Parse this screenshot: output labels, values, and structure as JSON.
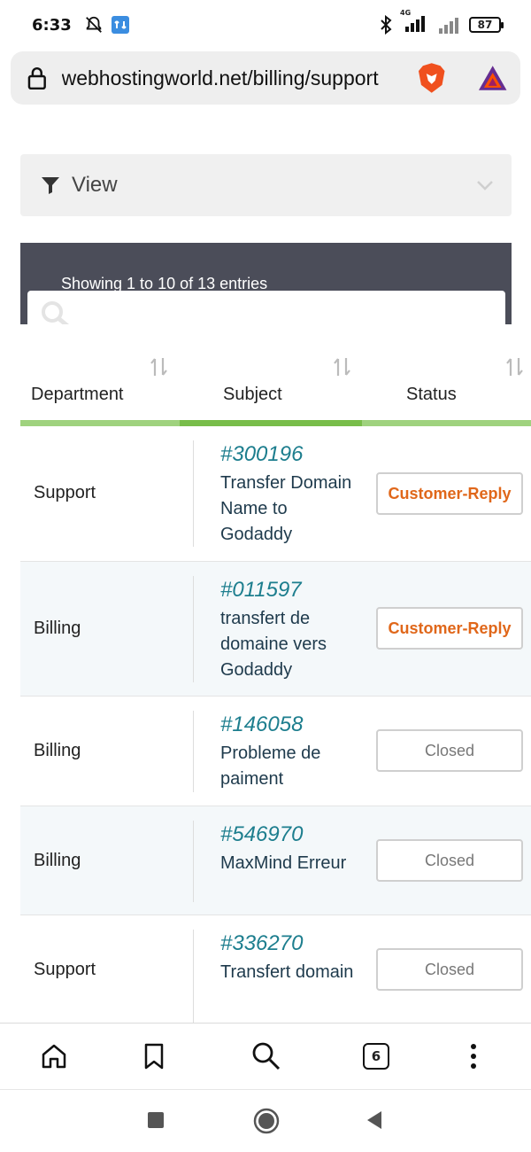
{
  "status_bar": {
    "time": "6:33",
    "network": "4G",
    "battery": "87"
  },
  "browser": {
    "url": "webhostingworld.net/billing/support",
    "tab_count": "6"
  },
  "filter": {
    "label": "View"
  },
  "table": {
    "info": "Showing 1 to 10 of 13 entries",
    "columns": [
      "Department",
      "Subject",
      "Status"
    ],
    "rows": [
      {
        "department": "Support",
        "ticket": "#300196",
        "subject": "Transfer Domain Name to Godaddy",
        "status": "Customer-Reply"
      },
      {
        "department": "Billing",
        "ticket": "#011597",
        "subject": "transfert de domaine vers Godaddy",
        "status": "Customer-Reply"
      },
      {
        "department": "Billing",
        "ticket": "#146058",
        "subject": "Probleme de paiment",
        "status": "Closed"
      },
      {
        "department": "Billing",
        "ticket": "#546970",
        "subject": "MaxMind Erreur",
        "status": "Closed"
      },
      {
        "department": "Support",
        "ticket": "#336270",
        "subject": "Transfert domain",
        "status": "Closed"
      }
    ]
  },
  "colors": {
    "ticket_link": "#1d7e8e",
    "customer_reply": "#e0671a",
    "closed": "#777777",
    "panel": "#4b4d59",
    "accent_green": "#78bd4a"
  }
}
